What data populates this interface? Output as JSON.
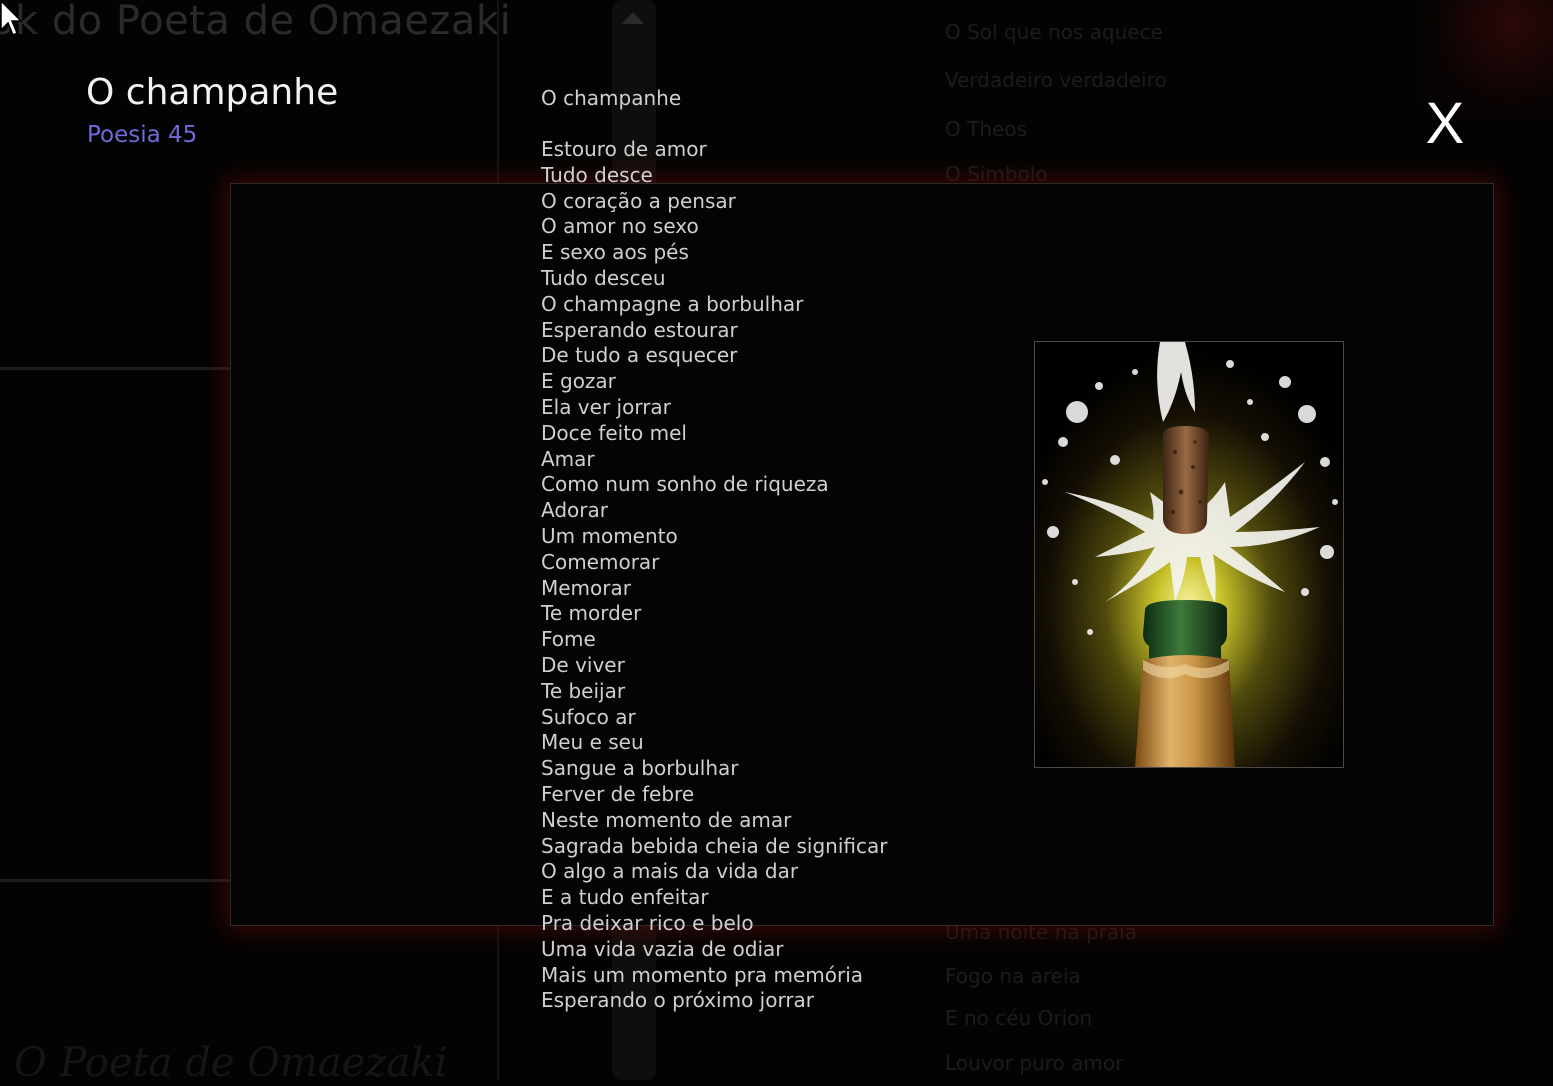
{
  "background_site": {
    "title": "ok do Poeta de Omaezaki",
    "right_list_top": [
      "O Sol que nos aquece",
      "Verdadeiro  verdadeiro",
      "O Theos",
      "O Simbolo"
    ],
    "right_list_bottom": [
      "Uma noite na praia",
      "Fogo na areia",
      "E no céu Orion",
      "Louvor puro amor"
    ],
    "footer_title": "O Poeta de Omaezaki"
  },
  "popup": {
    "title": "O champanhe",
    "subtitle": "Poesia 45",
    "close_label": "X",
    "poem_heading": "O champanhe",
    "poem_lines": [
      "Estouro de amor",
      "Tudo desce",
      "O coração a pensar",
      "O amor no sexo",
      "E sexo aos pés",
      "Tudo desceu",
      "O champagne a borbulhar",
      "Esperando estourar",
      "De tudo a esquecer",
      "E gozar",
      "Ela ver jorrar",
      "Doce feito mel",
      "Amar",
      "Como num sonho de riqueza",
      "Adorar",
      "Um momento",
      "Comemorar",
      "Memorar",
      "Te morder",
      "Fome",
      "De viver",
      "Te beijar",
      "Sufoco ar",
      "Meu e seu",
      "Sangue a borbulhar",
      "Ferver de febre",
      "Neste momento de amar",
      "Sagrada bebida cheia de significar",
      "O algo a mais da vida dar",
      "E a tudo enfeitar",
      "Pra deixar rico e belo",
      "Uma vida vazia de odiar",
      "Mais um momento pra memória",
      "Esperando o próximo jorrar"
    ],
    "image_subject": "champagne-bottle-popping-cork"
  },
  "colors": {
    "background": "#030303",
    "title": "#f2f2f2",
    "subtitle": "#6f6ad8",
    "poem_text": "#cfcfcf",
    "panel_glow": "#6e0a0a"
  },
  "icons": {
    "cursor": "mouse-pointer-icon",
    "close": "close-icon",
    "scroll_up": "scroll-up-arrow-icon"
  }
}
